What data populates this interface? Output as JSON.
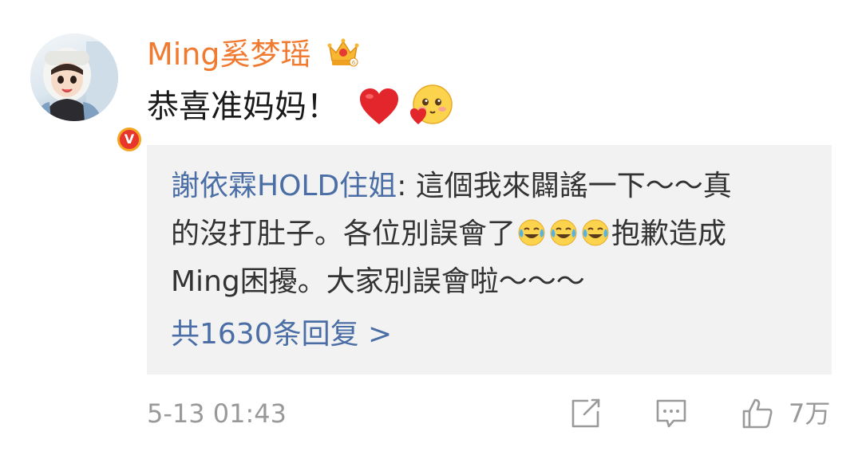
{
  "comment": {
    "username": "Ming奚梦瑶",
    "text": "恭喜准妈妈！",
    "timestamp": "5-13 01:43",
    "like_count": "7万",
    "icons": {
      "crown": "vip-crown-icon",
      "heart": "red-heart-emoji",
      "blush": "blush-kiss-emoji",
      "verified": "verified-v-badge"
    }
  },
  "reply": {
    "author": "謝依霖HOLD住姐",
    "separator": ": ",
    "line1_rest": "這個我來闢謠一下～～真",
    "line2_start": "的沒打肚子。各位別誤會了",
    "line2_end": "抱歉造成",
    "line3": "Ming困擾。大家別誤會啦～～～",
    "emoji_icon": "laugh-cry-emoji",
    "reply_count": "共1630条回复 >"
  },
  "colors": {
    "username": "#f07a2f",
    "link": "#4a6ea5",
    "text": "#1a1a1a",
    "meta": "#999999",
    "reply_bg": "#f2f2f2"
  }
}
